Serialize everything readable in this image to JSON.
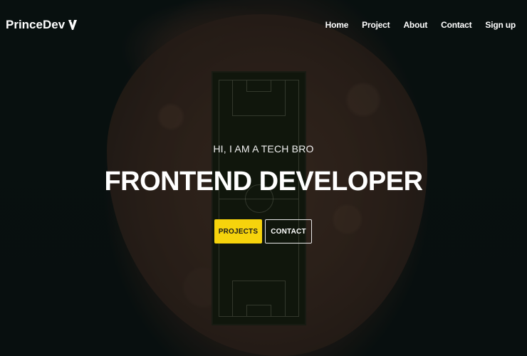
{
  "brand": {
    "name": "PrinceDev",
    "icon": "v-logo-icon"
  },
  "nav": {
    "items": [
      {
        "label": "Home"
      },
      {
        "label": "Project"
      },
      {
        "label": "About"
      },
      {
        "label": "Contact"
      },
      {
        "label": "Sign up"
      }
    ]
  },
  "hero": {
    "subtitle": "HI, I AM A TECH BRO",
    "title": "FRONTEND DEVELOPER",
    "primary_button": "PROJECTS",
    "secondary_button": "CONTACT",
    "background": "aerial island with football pitch"
  },
  "colors": {
    "accent": "#f6d30c",
    "text": "#ffffff",
    "background": "#0d1614"
  }
}
